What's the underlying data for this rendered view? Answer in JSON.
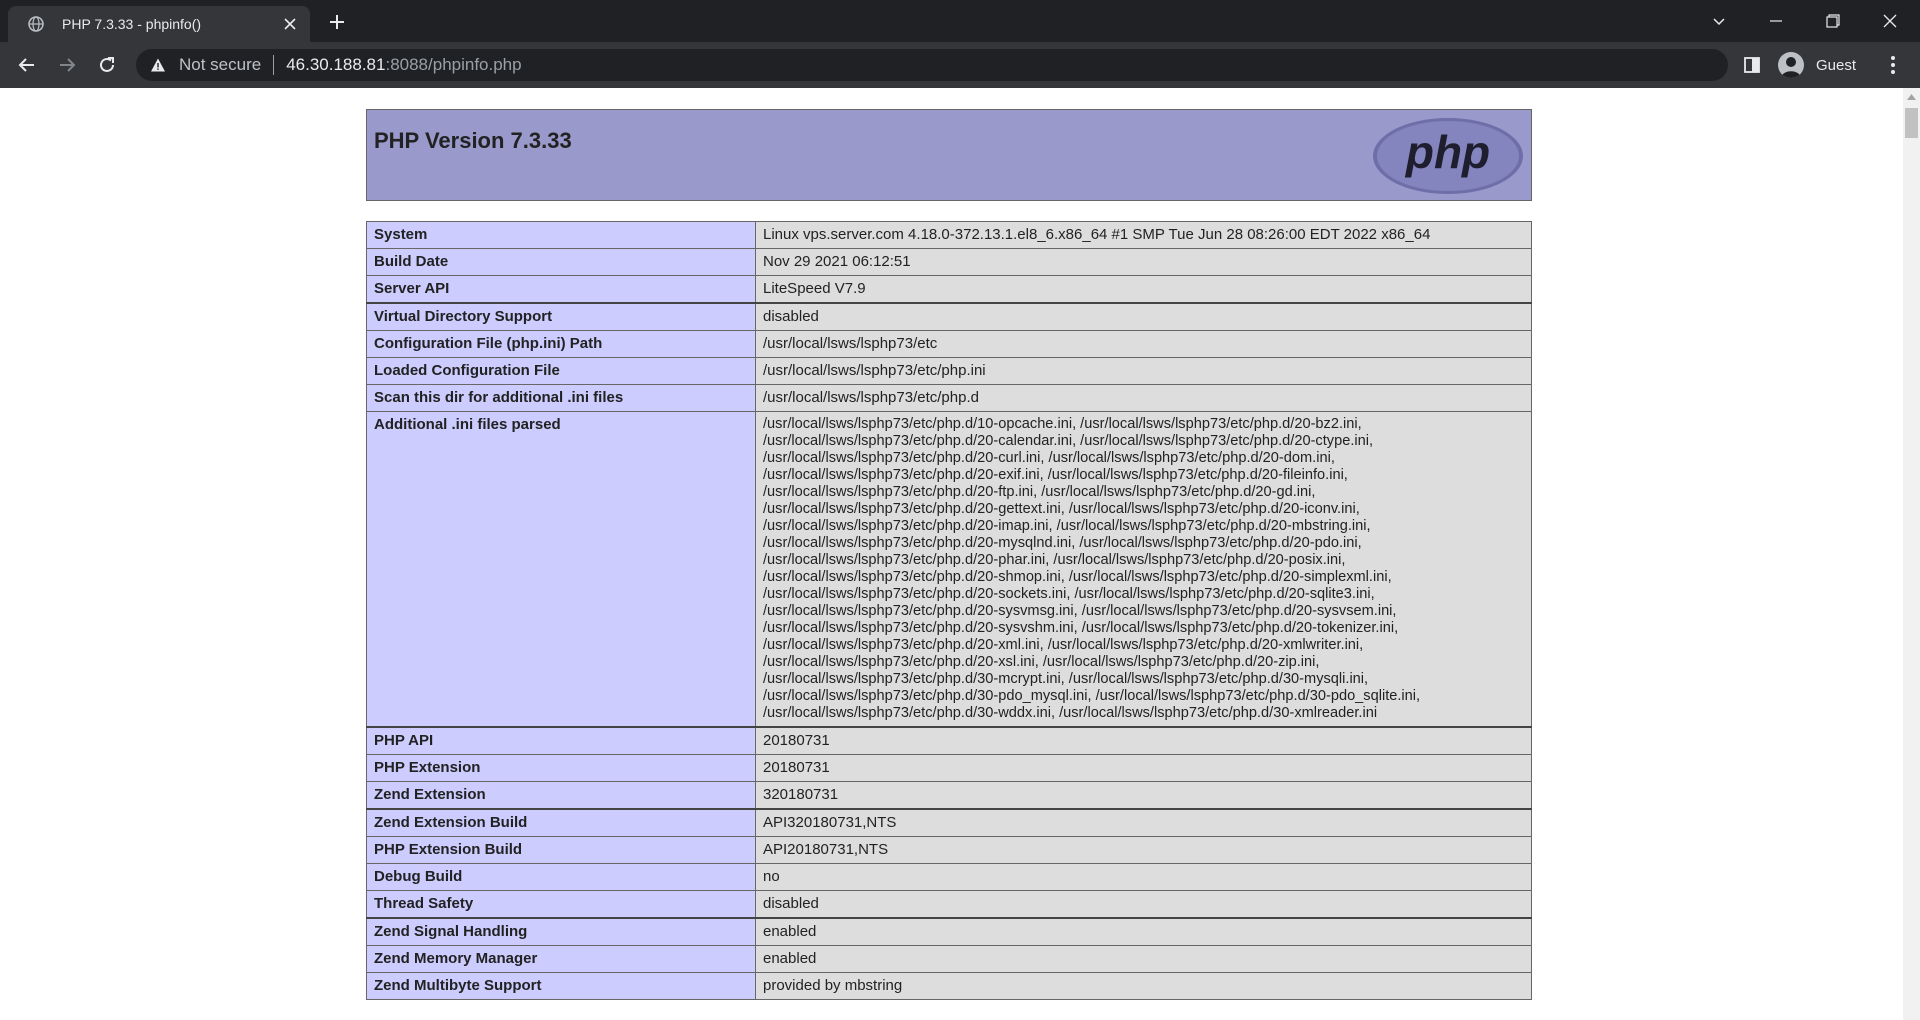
{
  "browser": {
    "tab_title": "PHP 7.3.33 - phpinfo()",
    "security_label": "Not secure",
    "url_host": "46.30.188.81",
    "url_rest": ":8088/phpinfo.php",
    "profile_name": "Guest"
  },
  "page": {
    "title": "PHP Version 7.3.33",
    "logo_text": "php",
    "rows": [
      {
        "key": "System",
        "value": "Linux vps.server.com 4.18.0-372.13.1.el8_6.x86_64 #1 SMP Tue Jun 28 08:26:00 EDT 2022 x86_64"
      },
      {
        "key": "Build Date",
        "value": "Nov 29 2021 06:12:51"
      },
      {
        "key": "Server API",
        "value": "LiteSpeed V7.9"
      },
      {
        "key": "Virtual Directory Support",
        "value": "disabled"
      },
      {
        "key": "Configuration File (php.ini) Path",
        "value": "/usr/local/lsws/lsphp73/etc"
      },
      {
        "key": "Loaded Configuration File",
        "value": "/usr/local/lsws/lsphp73/etc/php.ini"
      },
      {
        "key": "Scan this dir for additional .ini files",
        "value": "/usr/local/lsws/lsphp73/etc/php.d"
      },
      {
        "key": "Additional .ini files parsed",
        "lines": [
          "/usr/local/lsws/lsphp73/etc/php.d/10-opcache.ini, /usr/local/lsws/lsphp73/etc/php.d/20-bz2.ini,",
          "/usr/local/lsws/lsphp73/etc/php.d/20-calendar.ini, /usr/local/lsws/lsphp73/etc/php.d/20-ctype.ini,",
          "/usr/local/lsws/lsphp73/etc/php.d/20-curl.ini, /usr/local/lsws/lsphp73/etc/php.d/20-dom.ini,",
          "/usr/local/lsws/lsphp73/etc/php.d/20-exif.ini, /usr/local/lsws/lsphp73/etc/php.d/20-fileinfo.ini,",
          "/usr/local/lsws/lsphp73/etc/php.d/20-ftp.ini, /usr/local/lsws/lsphp73/etc/php.d/20-gd.ini,",
          "/usr/local/lsws/lsphp73/etc/php.d/20-gettext.ini, /usr/local/lsws/lsphp73/etc/php.d/20-iconv.ini,",
          "/usr/local/lsws/lsphp73/etc/php.d/20-imap.ini, /usr/local/lsws/lsphp73/etc/php.d/20-mbstring.ini,",
          "/usr/local/lsws/lsphp73/etc/php.d/20-mysqlnd.ini, /usr/local/lsws/lsphp73/etc/php.d/20-pdo.ini,",
          "/usr/local/lsws/lsphp73/etc/php.d/20-phar.ini, /usr/local/lsws/lsphp73/etc/php.d/20-posix.ini,",
          "/usr/local/lsws/lsphp73/etc/php.d/20-shmop.ini, /usr/local/lsws/lsphp73/etc/php.d/20-simplexml.ini,",
          "/usr/local/lsws/lsphp73/etc/php.d/20-sockets.ini, /usr/local/lsws/lsphp73/etc/php.d/20-sqlite3.ini,",
          "/usr/local/lsws/lsphp73/etc/php.d/20-sysvmsg.ini, /usr/local/lsws/lsphp73/etc/php.d/20-sysvsem.ini,",
          "/usr/local/lsws/lsphp73/etc/php.d/20-sysvshm.ini, /usr/local/lsws/lsphp73/etc/php.d/20-tokenizer.ini,",
          "/usr/local/lsws/lsphp73/etc/php.d/20-xml.ini, /usr/local/lsws/lsphp73/etc/php.d/20-xmlwriter.ini,",
          "/usr/local/lsws/lsphp73/etc/php.d/20-xsl.ini, /usr/local/lsws/lsphp73/etc/php.d/20-zip.ini,",
          "/usr/local/lsws/lsphp73/etc/php.d/30-mcrypt.ini, /usr/local/lsws/lsphp73/etc/php.d/30-mysqli.ini,",
          "/usr/local/lsws/lsphp73/etc/php.d/30-pdo_mysql.ini, /usr/local/lsws/lsphp73/etc/php.d/30-pdo_sqlite.ini,",
          "/usr/local/lsws/lsphp73/etc/php.d/30-wddx.ini, /usr/local/lsws/lsphp73/etc/php.d/30-xmlreader.ini"
        ]
      },
      {
        "key": "PHP API",
        "value": "20180731"
      },
      {
        "key": "PHP Extension",
        "value": "20180731"
      },
      {
        "key": "Zend Extension",
        "value": "320180731"
      },
      {
        "key": "Zend Extension Build",
        "value": "API320180731,NTS"
      },
      {
        "key": "PHP Extension Build",
        "value": "API20180731,NTS"
      },
      {
        "key": "Debug Build",
        "value": "no"
      },
      {
        "key": "Thread Safety",
        "value": "disabled"
      },
      {
        "key": "Zend Signal Handling",
        "value": "enabled"
      },
      {
        "key": "Zend Memory Manager",
        "value": "enabled"
      },
      {
        "key": "Zend Multibyte Support",
        "value": "provided by mbstring"
      }
    ]
  }
}
